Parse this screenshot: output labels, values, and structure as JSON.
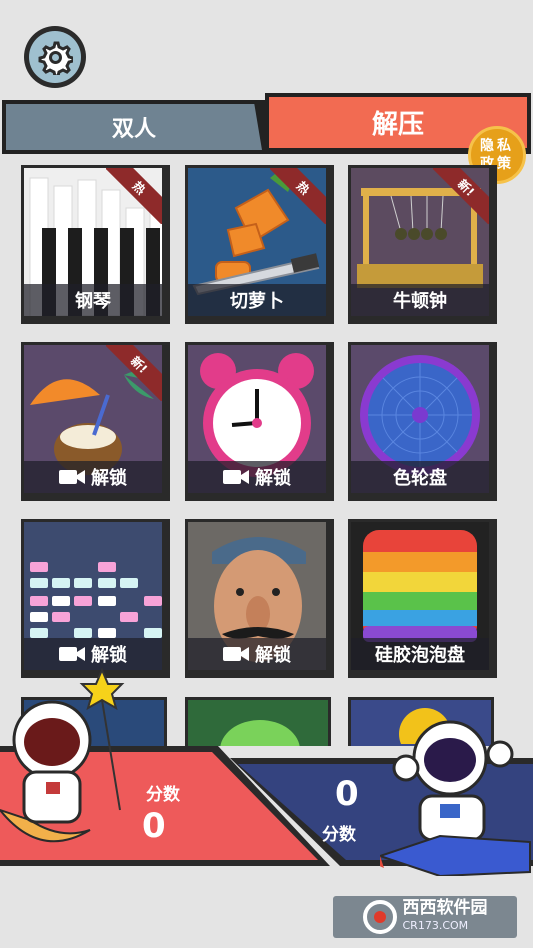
{
  "tabs": {
    "left_label": "双人",
    "right_label": "解压"
  },
  "privacy_badge": {
    "line1": "隐私",
    "line2": "政策"
  },
  "tiles": [
    {
      "name": "钢琴",
      "badge": "热"
    },
    {
      "name": "切萝卜",
      "badge": "热"
    },
    {
      "name": "牛顿钟",
      "badge": "新!"
    },
    {
      "name": "解锁",
      "badge": "新!"
    },
    {
      "name": "解锁",
      "badge": ""
    },
    {
      "name": "色轮盘",
      "badge": ""
    },
    {
      "name": "解锁",
      "badge": ""
    },
    {
      "name": "解锁",
      "badge": ""
    },
    {
      "name": "硅胶泡泡盘",
      "badge": ""
    }
  ],
  "score": {
    "left_label": "分数",
    "left_value": "0",
    "right_label": "分数",
    "right_value": "0"
  },
  "footer": {
    "brand": "西西软件园",
    "domain": "CR173.COM"
  },
  "colors": {
    "accent": "#f26b52",
    "tab_inactive": "#6f8392",
    "score_left": "#ef5a5a",
    "score_right": "#34437f"
  }
}
